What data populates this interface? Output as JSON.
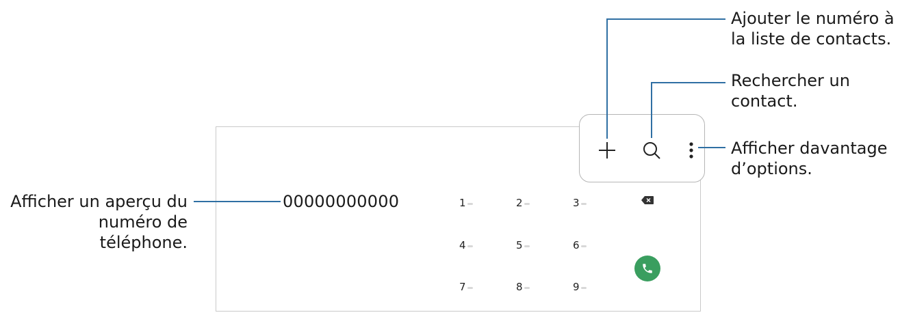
{
  "callouts": {
    "add_contact": [
      "Ajouter le numéro à",
      "la liste de contacts."
    ],
    "search_contact": [
      "Rechercher un",
      "contact."
    ],
    "more_options": [
      "Afficher davantage",
      "d’options."
    ],
    "preview_number": [
      "Afficher un aperçu du",
      "numéro de",
      "téléphone."
    ]
  },
  "dialer": {
    "number": "00000000000",
    "keys": [
      "1",
      "2",
      "3",
      "4",
      "5",
      "6",
      "7",
      "8",
      "9"
    ]
  },
  "icons": {
    "add": "plus-icon",
    "search": "search-icon",
    "more": "more-options-icon",
    "backspace": "backspace-icon",
    "call": "phone-icon"
  },
  "colors": {
    "leader_line": "#2f6fa3",
    "call_button": "#3a9e5f"
  }
}
